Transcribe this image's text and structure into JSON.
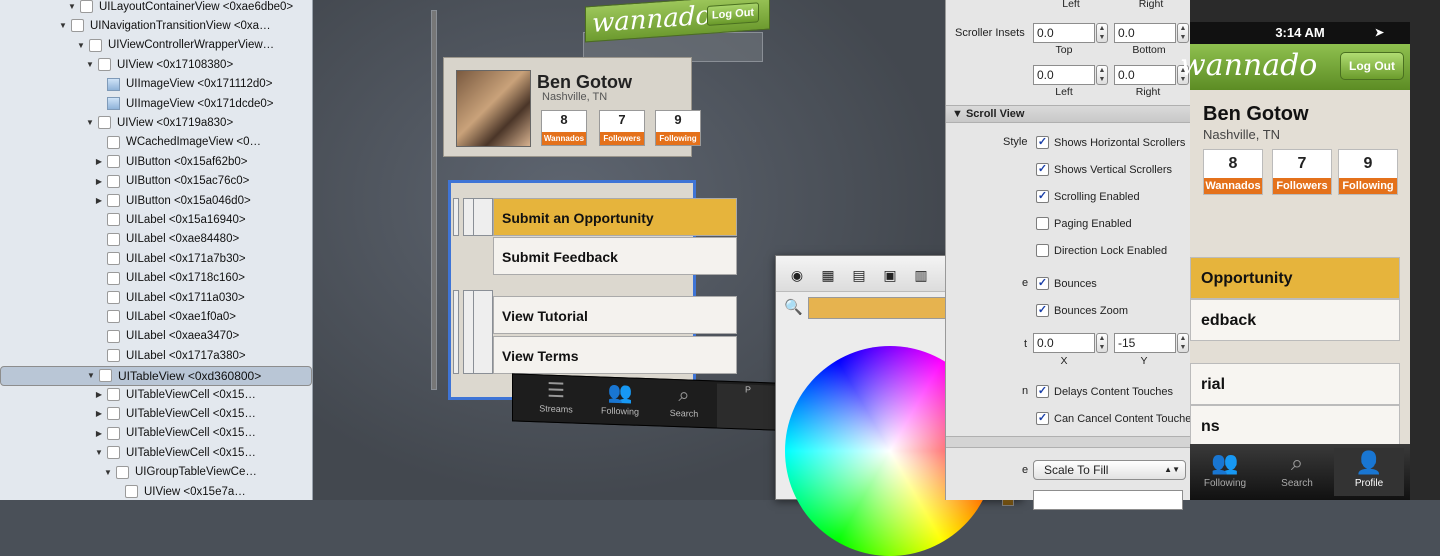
{
  "tree": {
    "nodes": [
      {
        "label": "UILayoutContainerView <0xae6dbe0>",
        "disc": "down",
        "icon": "box"
      },
      {
        "label": "UINavigationTransitionView <0xa…",
        "disc": "down",
        "icon": "box"
      },
      {
        "label": "UIViewControllerWrapperView…",
        "disc": "down",
        "icon": "box"
      },
      {
        "label": "UIView <0x17108380>",
        "disc": "down",
        "icon": "box"
      },
      {
        "label": "UIImageView <0x171112d0>",
        "disc": "none",
        "icon": "image"
      },
      {
        "label": "UIImageView <0x171dcde0>",
        "disc": "none",
        "icon": "image"
      },
      {
        "label": "UIView <0x1719a830>",
        "disc": "down",
        "icon": "box"
      },
      {
        "label": "WCachedImageView <0…",
        "disc": "none",
        "icon": "box"
      },
      {
        "label": "UIButton <0x15af62b0>",
        "disc": "right",
        "icon": "box"
      },
      {
        "label": "UIButton <0x15ac76c0>",
        "disc": "right",
        "icon": "box"
      },
      {
        "label": "UIButton <0x15a046d0>",
        "disc": "right",
        "icon": "box"
      },
      {
        "label": "UILabel <0x15a16940>",
        "disc": "none",
        "icon": "box"
      },
      {
        "label": "UILabel <0xae84480>",
        "disc": "none",
        "icon": "box"
      },
      {
        "label": "UILabel <0x171a7b30>",
        "disc": "none",
        "icon": "box"
      },
      {
        "label": "UILabel <0x1718c160>",
        "disc": "none",
        "icon": "box"
      },
      {
        "label": "UILabel <0x1711a030>",
        "disc": "none",
        "icon": "box"
      },
      {
        "label": "UILabel <0xae1f0a0>",
        "disc": "none",
        "icon": "box"
      },
      {
        "label": "UILabel <0xaea3470>",
        "disc": "none",
        "icon": "box"
      },
      {
        "label": "UILabel <0x1717a380>",
        "disc": "none",
        "icon": "box"
      },
      {
        "label": "UITableView <0xd360800>",
        "disc": "down",
        "icon": "box",
        "selected": true
      },
      {
        "label": "UITableViewCell <0x15…",
        "disc": "right",
        "icon": "box"
      },
      {
        "label": "UITableViewCell <0x15…",
        "disc": "right",
        "icon": "box"
      },
      {
        "label": "UITableViewCell <0x15…",
        "disc": "right",
        "icon": "box"
      },
      {
        "label": "UITableViewCell <0x15…",
        "disc": "down",
        "icon": "box"
      },
      {
        "label": "UIGroupTableViewCe…",
        "disc": "down",
        "icon": "box"
      },
      {
        "label": "UIView <0x15e7a…",
        "disc": "none",
        "icon": "box"
      }
    ],
    "indents": [
      5,
      4,
      6,
      7,
      8,
      8,
      7,
      8,
      8,
      8,
      8,
      8,
      8,
      8,
      8,
      8,
      8,
      8,
      8,
      7,
      8,
      8,
      8,
      8,
      9,
      10
    ]
  },
  "canvas": {
    "logo": "wannado",
    "logout": "Log Out",
    "name": "Ben Gotow",
    "location": "Nashville, TN",
    "stats": [
      {
        "n": "8",
        "t": "Wannados"
      },
      {
        "n": "7",
        "t": "Followers"
      },
      {
        "n": "9",
        "t": "Following"
      }
    ],
    "rows": [
      "Submit an Opportunity",
      "Submit Feedback",
      "View Tutorial",
      "View Terms"
    ],
    "tabs": [
      {
        "g": "☰",
        "t": "Streams"
      },
      {
        "g": "👥",
        "t": "Following"
      },
      {
        "g": "⌕",
        "t": "Search"
      },
      {
        "g": "",
        "t": "P"
      }
    ]
  },
  "picker": {
    "swatch_color": "#e6b34f",
    "tools": [
      "color-wheel-icon",
      "sliders-icon",
      "palettes-icon",
      "image-palette-icon",
      "crayons-icon",
      "pencil-icon",
      "spectrum-icon"
    ],
    "tool_glyphs": [
      "◉",
      "▦",
      "▤",
      "▣",
      "▥",
      "✎",
      "◎"
    ]
  },
  "inspector": {
    "top_left": "Left",
    "top_right": "Right",
    "scroller_insets_label": "Scroller Insets",
    "inset_top": "0.0",
    "inset_bottom": "0.0",
    "inset_left": "0.0",
    "inset_right": "0.0",
    "cap_top": "Top",
    "cap_bottom": "Bottom",
    "cap_left": "Left",
    "cap_right": "Right",
    "section_scroll": "Scroll View",
    "style_label": "Style",
    "checks": [
      {
        "label": "Shows Horizontal Scrollers",
        "checked": true
      },
      {
        "label": "Shows Vertical Scrollers",
        "checked": true
      },
      {
        "label": "Scrolling Enabled",
        "checked": true
      },
      {
        "label": "Paging Enabled",
        "checked": false
      },
      {
        "label": "Direction Lock Enabled",
        "checked": false
      },
      {
        "label": "Bounces",
        "checked": true
      },
      {
        "label": "Bounces Zoom",
        "checked": true
      },
      {
        "label": "Delays Content Touches",
        "checked": true
      },
      {
        "label": "Can Cancel Content Touches",
        "checked": true
      }
    ],
    "partial_label_e": "e",
    "partial_label_t": "t",
    "partial_label_n": "n",
    "partial_label_e2": "e",
    "offset_x": "0.0",
    "offset_y": "-15",
    "cap_x": "X",
    "cap_y": "Y",
    "mode_value": "Scale To Fill"
  },
  "sim": {
    "time": "3:14 AM",
    "logo": "wannado",
    "logout": "Log Out",
    "name": "Ben Gotow",
    "location": "Nashville, TN",
    "stats": [
      {
        "n": "8",
        "t": "Wannados"
      },
      {
        "n": "7",
        "t": "Followers"
      },
      {
        "n": "9",
        "t": "Following"
      }
    ],
    "rows": [
      "Opportunity",
      "edback",
      "rial",
      "ns"
    ],
    "tabs": [
      {
        "g": "👥",
        "t": "Following"
      },
      {
        "g": "⌕",
        "t": "Search"
      },
      {
        "g": "👤",
        "t": "Profile"
      }
    ]
  }
}
